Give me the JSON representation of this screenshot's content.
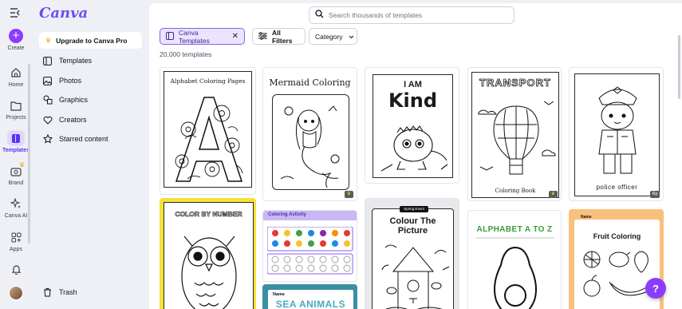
{
  "rail": {
    "items": [
      {
        "label": "Create"
      },
      {
        "label": "Home"
      },
      {
        "label": "Projects"
      },
      {
        "label": "Templates"
      },
      {
        "label": "Brand"
      },
      {
        "label": "Canva AI"
      },
      {
        "label": "Apps"
      }
    ]
  },
  "sidebar": {
    "logo": "Canva",
    "upgrade_label": "Upgrade to Canva Pro",
    "items": [
      {
        "label": "Templates"
      },
      {
        "label": "Photos"
      },
      {
        "label": "Graphics"
      },
      {
        "label": "Creators"
      },
      {
        "label": "Starred content"
      }
    ],
    "trash_label": "Trash"
  },
  "search": {
    "placeholder": "Search thousands of templates"
  },
  "filters": {
    "selected_chip": "Canva Templates",
    "all_filters": "All Filters",
    "category": "Category"
  },
  "results_count": "20,000 templates",
  "templates": [
    {
      "title": "Alphabet Coloring Pages"
    },
    {
      "title": "Mermaid Coloring"
    },
    {
      "title_line1": "I AM",
      "title_line2": "Kind"
    },
    {
      "title": "TRANSPORT",
      "footer": "Coloring Book"
    },
    {
      "caption": "police officer",
      "badge": "Rp"
    },
    {
      "title": "COLOR BY NUMBER"
    },
    {
      "title": "Coloring Activity"
    },
    {
      "tag": "Spring Event",
      "title": "Colour The Picture"
    },
    {
      "title": "ALPHABET A TO Z"
    },
    {
      "label": "Name",
      "title": "Fruit Coloring"
    },
    {
      "label": "Name",
      "title": "SEA ANIMALS"
    }
  ],
  "help_label": "?",
  "colors": {
    "accent": "#8b3dff",
    "brand": "#6a4cf6",
    "crown": "#f7a21c"
  }
}
